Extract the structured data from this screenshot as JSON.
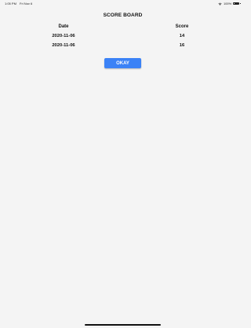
{
  "status_bar": {
    "time": "1:05 PM",
    "date": "Fri Nov 6",
    "battery": "100%",
    "icons": [
      "wifi-icon",
      "battery-icon"
    ]
  },
  "title": "SCORE BOARD",
  "table": {
    "headers": {
      "date": "Date",
      "score": "Score"
    },
    "rows": [
      {
        "date": "2020-11-06",
        "score": "14"
      },
      {
        "date": "2020-11-06",
        "score": "16"
      }
    ]
  },
  "button": {
    "label": "OKAY"
  },
  "colors": {
    "background": "#f4f4f4",
    "button": "#3b82f6",
    "button_text": "#ffffff"
  }
}
